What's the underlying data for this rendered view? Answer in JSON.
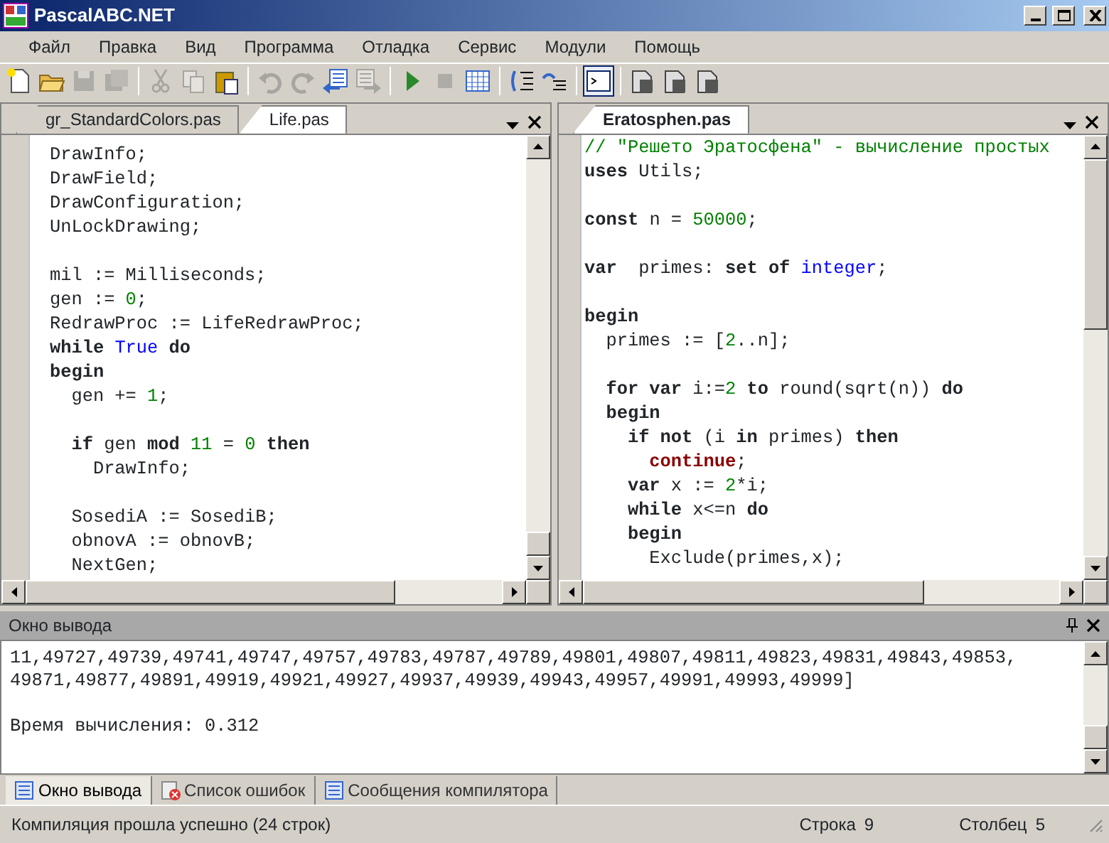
{
  "window": {
    "title": "PascalABC.NET"
  },
  "menu": [
    {
      "label": "Файл"
    },
    {
      "label": "Правка"
    },
    {
      "label": "Вид"
    },
    {
      "label": "Программа"
    },
    {
      "label": "Отладка"
    },
    {
      "label": "Сервис"
    },
    {
      "label": "Модули"
    },
    {
      "label": "Помощь"
    }
  ],
  "toolbar": [
    {
      "kind": "new",
      "disabled": false,
      "pressed": false
    },
    {
      "kind": "open",
      "disabled": false,
      "pressed": false
    },
    {
      "kind": "save",
      "disabled": true,
      "pressed": false
    },
    {
      "kind": "saveall",
      "disabled": true,
      "pressed": false
    },
    {
      "kind": "sep"
    },
    {
      "kind": "cut",
      "disabled": true,
      "pressed": false
    },
    {
      "kind": "copy",
      "disabled": true,
      "pressed": false
    },
    {
      "kind": "paste",
      "disabled": false,
      "pressed": false
    },
    {
      "kind": "sep"
    },
    {
      "kind": "undo",
      "disabled": true,
      "pressed": false
    },
    {
      "kind": "redo",
      "disabled": true,
      "pressed": false
    },
    {
      "kind": "back",
      "disabled": false,
      "pressed": false
    },
    {
      "kind": "forward",
      "disabled": true,
      "pressed": false
    },
    {
      "kind": "sep"
    },
    {
      "kind": "run",
      "disabled": false,
      "pressed": false
    },
    {
      "kind": "stop",
      "disabled": true,
      "pressed": false
    },
    {
      "kind": "grid",
      "disabled": false,
      "pressed": false
    },
    {
      "kind": "sep"
    },
    {
      "kind": "stepinto",
      "disabled": false,
      "pressed": false
    },
    {
      "kind": "stepover",
      "disabled": false,
      "pressed": false
    },
    {
      "kind": "sep"
    },
    {
      "kind": "console",
      "disabled": false,
      "pressed": true
    },
    {
      "kind": "sep"
    },
    {
      "kind": "docd",
      "disabled": false,
      "pressed": false
    },
    {
      "kind": "docl",
      "disabled": false,
      "pressed": false
    },
    {
      "kind": "docr",
      "disabled": false,
      "pressed": false
    }
  ],
  "editors": [
    {
      "focused": false,
      "tabs": [
        {
          "label": "gr_StandardColors.pas",
          "selected": false
        },
        {
          "label": "Life.pas",
          "selected": true
        }
      ],
      "lines": [
        {
          "kind": "code",
          "tokens": [
            {
              "kind": "plain",
              "text": "DrawInfo;"
            }
          ]
        },
        {
          "kind": "code",
          "tokens": [
            {
              "kind": "plain",
              "text": "DrawField;"
            }
          ]
        },
        {
          "kind": "code",
          "tokens": [
            {
              "kind": "plain",
              "text": "DrawConfiguration;"
            }
          ]
        },
        {
          "kind": "code",
          "tokens": [
            {
              "kind": "plain",
              "text": "UnLockDrawing;"
            }
          ]
        },
        {
          "kind": "blank"
        },
        {
          "kind": "code",
          "tokens": [
            {
              "kind": "plain",
              "text": "mil := Milliseconds;"
            }
          ]
        },
        {
          "kind": "code",
          "tokens": [
            {
              "kind": "plain",
              "text": "gen := "
            },
            {
              "kind": "number",
              "text": "0"
            },
            {
              "kind": "plain",
              "text": ";"
            }
          ]
        },
        {
          "kind": "code",
          "tokens": [
            {
              "kind": "plain",
              "text": "RedrawProc := LifeRedrawProc;"
            }
          ]
        },
        {
          "kind": "code",
          "tokens": [
            {
              "kind": "keyword",
              "text": "while"
            },
            {
              "kind": "type",
              "text": " True"
            },
            {
              "kind": "keyword",
              "text": " do"
            }
          ]
        },
        {
          "kind": "code",
          "tokens": [
            {
              "kind": "keyword",
              "text": "begin"
            }
          ]
        },
        {
          "kind": "code",
          "tokens": [
            {
              "kind": "plain",
              "text": "  gen += "
            },
            {
              "kind": "number",
              "text": "1"
            },
            {
              "kind": "plain",
              "text": ";"
            }
          ]
        },
        {
          "kind": "blank"
        },
        {
          "kind": "code",
          "tokens": [
            {
              "kind": "keyword",
              "text": "  if"
            },
            {
              "kind": "plain",
              "text": " gen "
            },
            {
              "kind": "keyword",
              "text": "mod"
            },
            {
              "kind": "number",
              "text": " 11"
            },
            {
              "kind": "plain",
              "text": " = "
            },
            {
              "kind": "number",
              "text": "0"
            },
            {
              "kind": "keyword",
              "text": " then"
            }
          ]
        },
        {
          "kind": "code",
          "tokens": [
            {
              "kind": "plain",
              "text": "    DrawInfo;"
            }
          ]
        },
        {
          "kind": "blank"
        },
        {
          "kind": "code",
          "tokens": [
            {
              "kind": "plain",
              "text": "  SosediA := SosediB;"
            }
          ]
        },
        {
          "kind": "code",
          "tokens": [
            {
              "kind": "plain",
              "text": "  obnovA := obnovB;"
            }
          ]
        },
        {
          "kind": "code",
          "tokens": [
            {
              "kind": "plain",
              "text": "  NextGen;"
            }
          ]
        }
      ]
    },
    {
      "focused": true,
      "tabs": [
        {
          "label": "Eratosphen.pas",
          "selected": true
        }
      ],
      "lines": [
        {
          "kind": "code",
          "tokens": [
            {
              "kind": "comment",
              "text": "// \"Решето Эратосфена\" - вычисление простых"
            }
          ]
        },
        {
          "kind": "code",
          "tokens": [
            {
              "kind": "keyword",
              "text": "uses"
            },
            {
              "kind": "plain",
              "text": " Utils;"
            }
          ]
        },
        {
          "kind": "blank"
        },
        {
          "kind": "code",
          "tokens": [
            {
              "kind": "keyword",
              "text": "const"
            },
            {
              "kind": "plain",
              "text": " n = "
            },
            {
              "kind": "number",
              "text": "50000"
            },
            {
              "kind": "plain",
              "text": ";"
            }
          ]
        },
        {
          "kind": "blank"
        },
        {
          "kind": "code",
          "tokens": [
            {
              "kind": "keyword",
              "text": "var"
            },
            {
              "kind": "plain",
              "text": "  primes: "
            },
            {
              "kind": "keyword",
              "text": "set of"
            },
            {
              "kind": "type",
              "text": " integer"
            },
            {
              "kind": "plain",
              "text": ";"
            }
          ]
        },
        {
          "kind": "blank"
        },
        {
          "kind": "code",
          "tokens": [
            {
              "kind": "keyword",
              "text": "begin"
            }
          ]
        },
        {
          "kind": "code",
          "tokens": [
            {
              "kind": "plain",
              "text": "  primes := ["
            },
            {
              "kind": "number",
              "text": "2"
            },
            {
              "kind": "plain",
              "text": "..n];"
            }
          ]
        },
        {
          "kind": "blank"
        },
        {
          "kind": "code",
          "tokens": [
            {
              "kind": "keyword",
              "text": "  for var"
            },
            {
              "kind": "plain",
              "text": " i:="
            },
            {
              "kind": "number",
              "text": "2"
            },
            {
              "kind": "keyword",
              "text": " to"
            },
            {
              "kind": "plain",
              "text": " round(sqrt(n)) "
            },
            {
              "kind": "keyword",
              "text": "do"
            }
          ]
        },
        {
          "kind": "code",
          "tokens": [
            {
              "kind": "keyword",
              "text": "  begin"
            }
          ]
        },
        {
          "kind": "code",
          "tokens": [
            {
              "kind": "keyword",
              "text": "    if not"
            },
            {
              "kind": "plain",
              "text": " (i "
            },
            {
              "kind": "keyword",
              "text": "in"
            },
            {
              "kind": "plain",
              "text": " primes) "
            },
            {
              "kind": "keyword",
              "text": "then"
            }
          ]
        },
        {
          "kind": "code",
          "tokens": [
            {
              "kind": "flow",
              "text": "      continue"
            },
            {
              "kind": "plain",
              "text": ";"
            }
          ]
        },
        {
          "kind": "code",
          "tokens": [
            {
              "kind": "keyword",
              "text": "    var"
            },
            {
              "kind": "plain",
              "text": " x := "
            },
            {
              "kind": "number",
              "text": "2"
            },
            {
              "kind": "plain",
              "text": "*i;"
            }
          ]
        },
        {
          "kind": "code",
          "tokens": [
            {
              "kind": "keyword",
              "text": "    while"
            },
            {
              "kind": "plain",
              "text": " x<=n "
            },
            {
              "kind": "keyword",
              "text": "do"
            }
          ]
        },
        {
          "kind": "code",
          "tokens": [
            {
              "kind": "keyword",
              "text": "    begin"
            }
          ]
        },
        {
          "kind": "code",
          "tokens": [
            {
              "kind": "plain",
              "text": "      Exclude(primes,x);"
            }
          ]
        }
      ]
    }
  ],
  "output": {
    "title": "Окно вывода",
    "lines": [
      {
        "kind": "text",
        "text": "11,49727,49739,49741,49747,49757,49783,49787,49789,49801,49807,49811,49823,49831,49843,49853,"
      },
      {
        "kind": "text",
        "text": "49871,49877,49891,49919,49921,49927,49937,49939,49943,49957,49991,49993,49999]"
      },
      {
        "kind": "blank"
      },
      {
        "kind": "text",
        "text": "Время вычисления: 0.312"
      }
    ],
    "tabs": [
      {
        "label": "Окно вывода",
        "kind": "output",
        "selected": true
      },
      {
        "label": "Список ошибок",
        "kind": "errors",
        "selected": false
      },
      {
        "label": "Сообщения компилятора",
        "kind": "messages",
        "selected": false
      }
    ]
  },
  "status_bar": {
    "message": "Компиляция прошла успешно (24 строк)",
    "line_label": "Строка",
    "line": "9",
    "column_label": "Столбец",
    "column": "5"
  }
}
